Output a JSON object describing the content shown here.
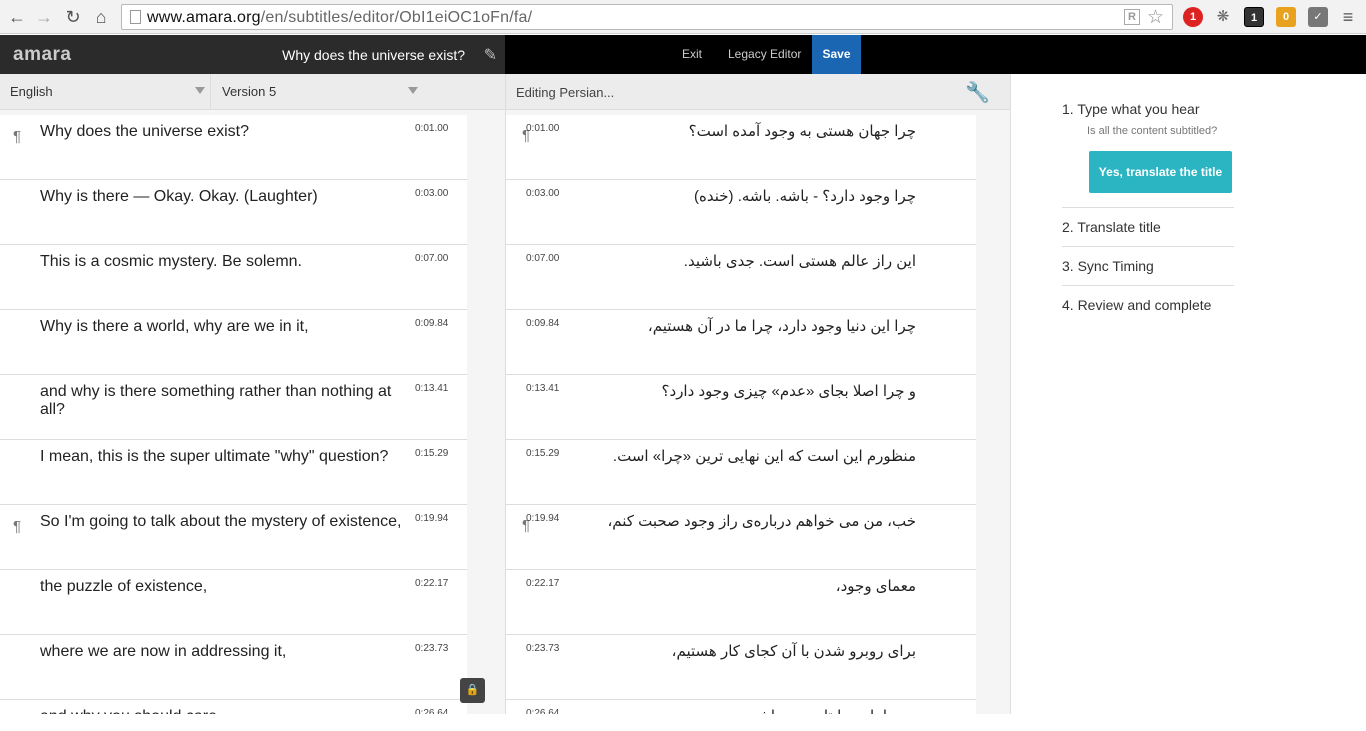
{
  "browser": {
    "url_host": "www.amara.org",
    "url_path": "/en/subtitles/editor/ObI1eiOC1oFn/fa/",
    "extension_badges": [
      "1",
      "1",
      "0"
    ]
  },
  "app": {
    "logo": "amara",
    "video_title": "Why does the universe exist?",
    "exit_label": "Exit",
    "legacy_editor_label": "Legacy Editor",
    "save_label": "Save"
  },
  "left": {
    "language": "English",
    "version": "Version 5",
    "rows": [
      {
        "text": "Why does the universe exist?",
        "time": "0:01.00",
        "para": true
      },
      {
        "text": "Why is there — Okay. Okay. (Laughter)",
        "time": "0:03.00",
        "para": false
      },
      {
        "text": "This is a cosmic mystery. Be solemn.",
        "time": "0:07.00",
        "para": false
      },
      {
        "text": "Why is there a world, why are we in it,",
        "time": "0:09.84",
        "para": false
      },
      {
        "text": "and why is there something rather than nothing at all?",
        "time": "0:13.41",
        "para": false
      },
      {
        "text": "I mean, this is the super ultimate \"why\" question?",
        "time": "0:15.29",
        "para": false
      },
      {
        "text": "So I'm going to talk about the mystery of existence,",
        "time": "0:19.94",
        "para": true
      },
      {
        "text": "the puzzle of existence,",
        "time": "0:22.17",
        "para": false
      },
      {
        "text": "where we are now in addressing it,",
        "time": "0:23.73",
        "para": false
      },
      {
        "text": "and why you should care",
        "time": "0:26.64",
        "para": false
      }
    ]
  },
  "middle": {
    "editing_label": "Editing Persian...",
    "rows": [
      {
        "text": "چرا جهان هستی به وجود آمده است؟",
        "time": "0:01.00",
        "para": true
      },
      {
        "text": "چرا وجود دارد؟ - باشه. باشه. (خنده)",
        "time": "0:03.00",
        "para": false
      },
      {
        "text": "این راز عالم هستی است. جدی باشید.",
        "time": "0:07.00",
        "para": false
      },
      {
        "text": "چرا این دنیا وجود دارد، چرا ما در آن هستیم،",
        "time": "0:09.84",
        "para": false
      },
      {
        "text": "و چرا اصلا بجای «عدم» چیزی وجود دارد؟",
        "time": "0:13.41",
        "para": false
      },
      {
        "text": "منظورم این است که این نهایی ترین «چرا» است.",
        "time": "0:15.29",
        "para": false
      },
      {
        "text": "خب، من می خواهم درباره‌ی راز وجود صحبت کنم،",
        "time": "0:19.94",
        "para": true
      },
      {
        "text": "معمای وجود،",
        "time": "0:22.17",
        "para": false
      },
      {
        "text": "برای روبرو شدن با آن کجای کار هستیم،",
        "time": "0:23.73",
        "para": false
      },
      {
        "text": "و چرا باید برایتان مهم باشد",
        "time": "0:26.64",
        "para": false
      }
    ]
  },
  "help": {
    "step1": "1. Type what you hear",
    "step1_question": "Is all the content subtitled?",
    "step1_button": "Yes, translate the title",
    "step2": "2. Translate title",
    "step3": "3. Sync Timing",
    "step4": "4. Review and complete"
  },
  "colors": {
    "save_button": "#1a66b3",
    "primary_button": "#2bb5c2",
    "topbar": "#000000"
  }
}
